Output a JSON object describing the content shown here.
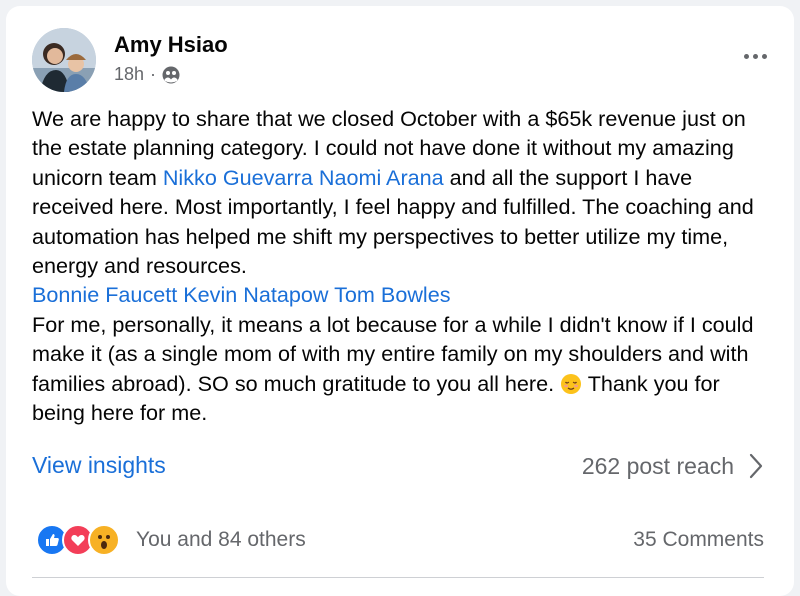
{
  "post": {
    "author": "Amy Hsiao",
    "time": "18h",
    "separator": "·",
    "privacy_icon": "friends-icon",
    "paragraph1_a": "We are happy to share that we closed October with a $65k revenue just on the estate planning category.  I could not have done it without my amazing unicorn team ",
    "mention1": "Nikko Guevarra",
    "mention2": "Naomi Arana",
    "paragraph1_b": " and all the support I have received here.  Most importantly, I feel happy and fulfilled. The coaching and automation has helped me shift my perspectives to better utilize my time, energy and resources.",
    "mention3": "Bonnie Faucett",
    "mention4": "Kevin Natapow",
    "mention5": "Tom Bowles",
    "paragraph2_a": "For me, personally, it means a lot because for a while I didn't know if I could make it (as a single mom of with my entire family on my shoulders and with families abroad).  SO so much gratitude to you all here. ",
    "emoji": "relieved-face-emoji",
    "paragraph2_b": " Thank you for being here for me."
  },
  "insights": {
    "link": "View insights",
    "reach": "262 post reach"
  },
  "footer": {
    "reactions": [
      "like-icon",
      "love-icon",
      "wow-icon"
    ],
    "reaction_text": "You and 84 others",
    "comments": "35 Comments"
  },
  "colors": {
    "link": "#1a6fd8",
    "secondary": "#65676b",
    "like": "#1877f2",
    "love": "#f33e58",
    "wow": "#f7b125"
  }
}
